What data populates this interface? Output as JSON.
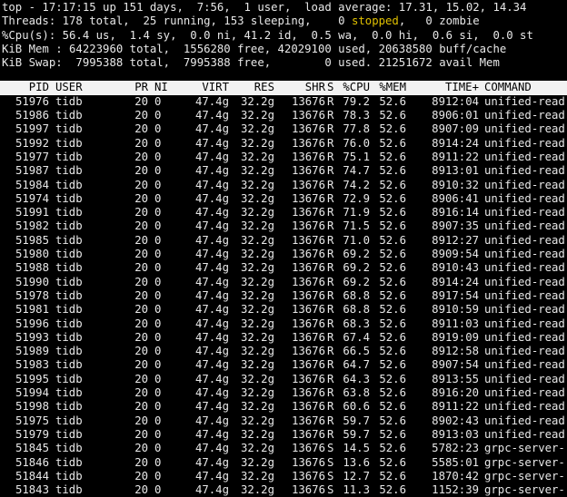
{
  "summary": {
    "line1": "top - 17:17:15 up 151 days,  7:56,  1 user,  load average: 17.31, 15.02, 14.34",
    "tasks_prefix": "Threads: 178 total,  25 running, 153 sleeping,    0 ",
    "tasks_stopped": "stopped",
    "tasks_suffix": ",   0 zombie",
    "cpu": "%Cpu(s): 56.4 us,  1.4 sy,  0.0 ni, 41.2 id,  0.5 wa,  0.0 hi,  0.6 si,  0.0 st",
    "mem": "KiB Mem : 64223960 total,  1556280 free, 42029100 used, 20638580 buff/cache",
    "swap": "KiB Swap:  7995388 total,  7995388 free,        0 used. 21251672 avail Mem"
  },
  "columns": {
    "pid": "PID",
    "user": "USER",
    "pr": "PR",
    "ni": "NI",
    "virt": "VIRT",
    "res": "RES",
    "shr": "SHR",
    "s": "S",
    "cpu": "%CPU",
    "mem": "%MEM",
    "time": "TIME+",
    "cmd": "COMMAND"
  },
  "processes": [
    {
      "pid": "51976",
      "user": "tidb",
      "pr": "20",
      "ni": "0",
      "virt": "47.4g",
      "res": "32.2g",
      "shr": "13676",
      "s": "R",
      "cpu": "79.2",
      "mem": "52.6",
      "time": "8912:04",
      "cmd": "unified-read-po"
    },
    {
      "pid": "51986",
      "user": "tidb",
      "pr": "20",
      "ni": "0",
      "virt": "47.4g",
      "res": "32.2g",
      "shr": "13676",
      "s": "R",
      "cpu": "78.3",
      "mem": "52.6",
      "time": "8906:01",
      "cmd": "unified-read-po"
    },
    {
      "pid": "51997",
      "user": "tidb",
      "pr": "20",
      "ni": "0",
      "virt": "47.4g",
      "res": "32.2g",
      "shr": "13676",
      "s": "R",
      "cpu": "77.8",
      "mem": "52.6",
      "time": "8907:09",
      "cmd": "unified-read-po"
    },
    {
      "pid": "51992",
      "user": "tidb",
      "pr": "20",
      "ni": "0",
      "virt": "47.4g",
      "res": "32.2g",
      "shr": "13676",
      "s": "R",
      "cpu": "76.0",
      "mem": "52.6",
      "time": "8914:24",
      "cmd": "unified-read-po"
    },
    {
      "pid": "51977",
      "user": "tidb",
      "pr": "20",
      "ni": "0",
      "virt": "47.4g",
      "res": "32.2g",
      "shr": "13676",
      "s": "R",
      "cpu": "75.1",
      "mem": "52.6",
      "time": "8911:22",
      "cmd": "unified-read-po"
    },
    {
      "pid": "51987",
      "user": "tidb",
      "pr": "20",
      "ni": "0",
      "virt": "47.4g",
      "res": "32.2g",
      "shr": "13676",
      "s": "R",
      "cpu": "74.7",
      "mem": "52.6",
      "time": "8913:01",
      "cmd": "unified-read-po"
    },
    {
      "pid": "51984",
      "user": "tidb",
      "pr": "20",
      "ni": "0",
      "virt": "47.4g",
      "res": "32.2g",
      "shr": "13676",
      "s": "R",
      "cpu": "74.2",
      "mem": "52.6",
      "time": "8910:32",
      "cmd": "unified-read-po"
    },
    {
      "pid": "51974",
      "user": "tidb",
      "pr": "20",
      "ni": "0",
      "virt": "47.4g",
      "res": "32.2g",
      "shr": "13676",
      "s": "R",
      "cpu": "72.9",
      "mem": "52.6",
      "time": "8906:41",
      "cmd": "unified-read-po"
    },
    {
      "pid": "51991",
      "user": "tidb",
      "pr": "20",
      "ni": "0",
      "virt": "47.4g",
      "res": "32.2g",
      "shr": "13676",
      "s": "R",
      "cpu": "71.9",
      "mem": "52.6",
      "time": "8916:14",
      "cmd": "unified-read-po"
    },
    {
      "pid": "51982",
      "user": "tidb",
      "pr": "20",
      "ni": "0",
      "virt": "47.4g",
      "res": "32.2g",
      "shr": "13676",
      "s": "R",
      "cpu": "71.5",
      "mem": "52.6",
      "time": "8907:35",
      "cmd": "unified-read-po"
    },
    {
      "pid": "51985",
      "user": "tidb",
      "pr": "20",
      "ni": "0",
      "virt": "47.4g",
      "res": "32.2g",
      "shr": "13676",
      "s": "R",
      "cpu": "71.0",
      "mem": "52.6",
      "time": "8912:27",
      "cmd": "unified-read-po"
    },
    {
      "pid": "51980",
      "user": "tidb",
      "pr": "20",
      "ni": "0",
      "virt": "47.4g",
      "res": "32.2g",
      "shr": "13676",
      "s": "R",
      "cpu": "69.2",
      "mem": "52.6",
      "time": "8909:54",
      "cmd": "unified-read-po"
    },
    {
      "pid": "51988",
      "user": "tidb",
      "pr": "20",
      "ni": "0",
      "virt": "47.4g",
      "res": "32.2g",
      "shr": "13676",
      "s": "R",
      "cpu": "69.2",
      "mem": "52.6",
      "time": "8910:43",
      "cmd": "unified-read-po"
    },
    {
      "pid": "51990",
      "user": "tidb",
      "pr": "20",
      "ni": "0",
      "virt": "47.4g",
      "res": "32.2g",
      "shr": "13676",
      "s": "R",
      "cpu": "69.2",
      "mem": "52.6",
      "time": "8914:24",
      "cmd": "unified-read-po"
    },
    {
      "pid": "51978",
      "user": "tidb",
      "pr": "20",
      "ni": "0",
      "virt": "47.4g",
      "res": "32.2g",
      "shr": "13676",
      "s": "R",
      "cpu": "68.8",
      "mem": "52.6",
      "time": "8917:54",
      "cmd": "unified-read-po"
    },
    {
      "pid": "51981",
      "user": "tidb",
      "pr": "20",
      "ni": "0",
      "virt": "47.4g",
      "res": "32.2g",
      "shr": "13676",
      "s": "R",
      "cpu": "68.8",
      "mem": "52.6",
      "time": "8910:59",
      "cmd": "unified-read-po"
    },
    {
      "pid": "51996",
      "user": "tidb",
      "pr": "20",
      "ni": "0",
      "virt": "47.4g",
      "res": "32.2g",
      "shr": "13676",
      "s": "R",
      "cpu": "68.3",
      "mem": "52.6",
      "time": "8911:03",
      "cmd": "unified-read-po"
    },
    {
      "pid": "51993",
      "user": "tidb",
      "pr": "20",
      "ni": "0",
      "virt": "47.4g",
      "res": "32.2g",
      "shr": "13676",
      "s": "R",
      "cpu": "67.4",
      "mem": "52.6",
      "time": "8919:09",
      "cmd": "unified-read-po"
    },
    {
      "pid": "51989",
      "user": "tidb",
      "pr": "20",
      "ni": "0",
      "virt": "47.4g",
      "res": "32.2g",
      "shr": "13676",
      "s": "R",
      "cpu": "66.5",
      "mem": "52.6",
      "time": "8912:58",
      "cmd": "unified-read-po"
    },
    {
      "pid": "51983",
      "user": "tidb",
      "pr": "20",
      "ni": "0",
      "virt": "47.4g",
      "res": "32.2g",
      "shr": "13676",
      "s": "R",
      "cpu": "64.7",
      "mem": "52.6",
      "time": "8907:54",
      "cmd": "unified-read-po"
    },
    {
      "pid": "51995",
      "user": "tidb",
      "pr": "20",
      "ni": "0",
      "virt": "47.4g",
      "res": "32.2g",
      "shr": "13676",
      "s": "R",
      "cpu": "64.3",
      "mem": "52.6",
      "time": "8913:55",
      "cmd": "unified-read-po"
    },
    {
      "pid": "51994",
      "user": "tidb",
      "pr": "20",
      "ni": "0",
      "virt": "47.4g",
      "res": "32.2g",
      "shr": "13676",
      "s": "R",
      "cpu": "63.8",
      "mem": "52.6",
      "time": "8916:20",
      "cmd": "unified-read-po"
    },
    {
      "pid": "51998",
      "user": "tidb",
      "pr": "20",
      "ni": "0",
      "virt": "47.4g",
      "res": "32.2g",
      "shr": "13676",
      "s": "R",
      "cpu": "60.6",
      "mem": "52.6",
      "time": "8911:22",
      "cmd": "unified-read-po"
    },
    {
      "pid": "51975",
      "user": "tidb",
      "pr": "20",
      "ni": "0",
      "virt": "47.4g",
      "res": "32.2g",
      "shr": "13676",
      "s": "R",
      "cpu": "59.7",
      "mem": "52.6",
      "time": "8902:43",
      "cmd": "unified-read-po"
    },
    {
      "pid": "51979",
      "user": "tidb",
      "pr": "20",
      "ni": "0",
      "virt": "47.4g",
      "res": "32.2g",
      "shr": "13676",
      "s": "R",
      "cpu": "59.7",
      "mem": "52.6",
      "time": "8913:03",
      "cmd": "unified-read-po"
    },
    {
      "pid": "51845",
      "user": "tidb",
      "pr": "20",
      "ni": "0",
      "virt": "47.4g",
      "res": "32.2g",
      "shr": "13676",
      "s": "S",
      "cpu": "14.5",
      "mem": "52.6",
      "time": "5782:23",
      "cmd": "grpc-server-3"
    },
    {
      "pid": "51846",
      "user": "tidb",
      "pr": "20",
      "ni": "0",
      "virt": "47.4g",
      "res": "32.2g",
      "shr": "13676",
      "s": "S",
      "cpu": "13.6",
      "mem": "52.6",
      "time": "5585:01",
      "cmd": "grpc-server-4"
    },
    {
      "pid": "51844",
      "user": "tidb",
      "pr": "20",
      "ni": "0",
      "virt": "47.4g",
      "res": "32.2g",
      "shr": "13676",
      "s": "S",
      "cpu": "12.7",
      "mem": "52.6",
      "time": "1870:42",
      "cmd": "grpc-server-2"
    },
    {
      "pid": "51843",
      "user": "tidb",
      "pr": "20",
      "ni": "0",
      "virt": "47.4g",
      "res": "32.2g",
      "shr": "13676",
      "s": "S",
      "cpu": "11.3",
      "mem": "52.6",
      "time": "1152:39",
      "cmd": "grpc-server-1"
    }
  ]
}
